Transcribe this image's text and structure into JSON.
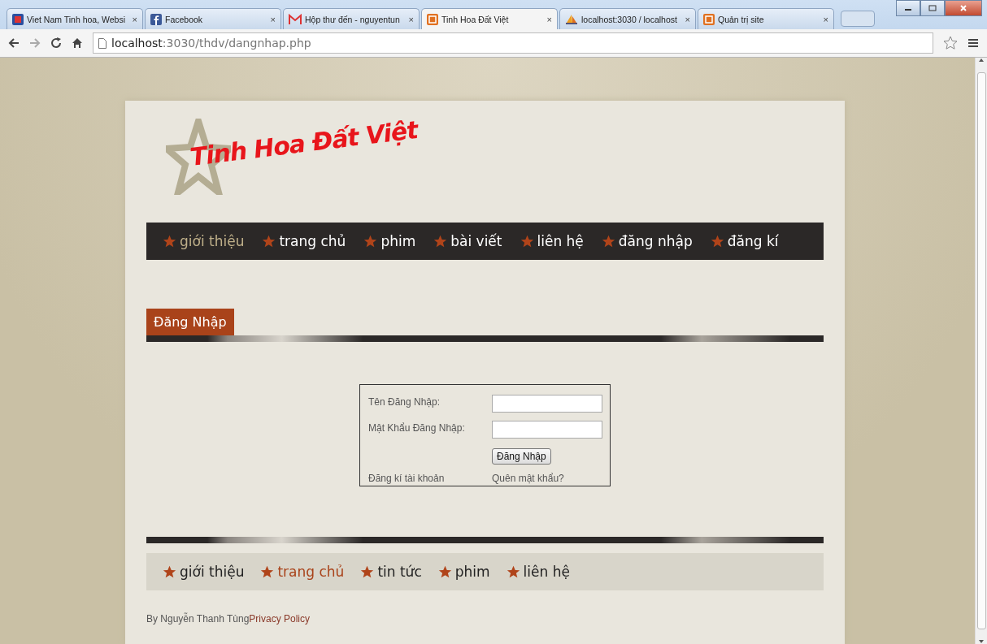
{
  "browser": {
    "tabs": [
      {
        "label": "Viet Nam Tinh hoa, Websi",
        "close": "×",
        "selected": false,
        "kind": "square"
      },
      {
        "label": "Facebook",
        "close": "×",
        "selected": false,
        "kind": "facebook"
      },
      {
        "label": "Hộp thư đến - nguyentun",
        "close": "×",
        "selected": false,
        "kind": "mail"
      },
      {
        "label": "Tinh Hoa Đất Việt",
        "close": "×",
        "selected": true,
        "kind": "site"
      },
      {
        "label": "localhost:3030 / localhost",
        "close": "×",
        "selected": false,
        "kind": "pma"
      },
      {
        "label": "Quản trị site",
        "close": "×",
        "selected": false,
        "kind": "site"
      }
    ],
    "address": {
      "host": "localhost",
      "rest": ":3030/thdv/dangnhap.php"
    }
  },
  "site": {
    "logo": "Tinh Hoa Đất Việt",
    "nav": [
      {
        "label": "giới thiệu",
        "selected": true
      },
      {
        "label": "trang chủ",
        "selected": false
      },
      {
        "label": "phim",
        "selected": false
      },
      {
        "label": "bài viết",
        "selected": false
      },
      {
        "label": "liên hệ",
        "selected": false
      },
      {
        "label": "đăng nhập",
        "selected": false
      },
      {
        "label": "đăng kí",
        "selected": false
      }
    ],
    "heading": "Đăng Nhập",
    "login": {
      "username_label": "Tên Đăng Nhập:",
      "password_label": "Mật Khẩu Đăng Nhập:",
      "submit": "Đăng Nhập",
      "register_link": "Đăng kí tài khoản",
      "forgot_link": "Quên mật khẩu?"
    },
    "footer_nav": [
      {
        "label": "giới thiệu",
        "selected": false
      },
      {
        "label": "trang chủ",
        "selected": true
      },
      {
        "label": "tin tức",
        "selected": false
      },
      {
        "label": "phim",
        "selected": false
      },
      {
        "label": "liên hệ",
        "selected": false
      }
    ],
    "credit": "By Nguyễn Thanh Tùng",
    "privacy": "Privacy Policy"
  }
}
